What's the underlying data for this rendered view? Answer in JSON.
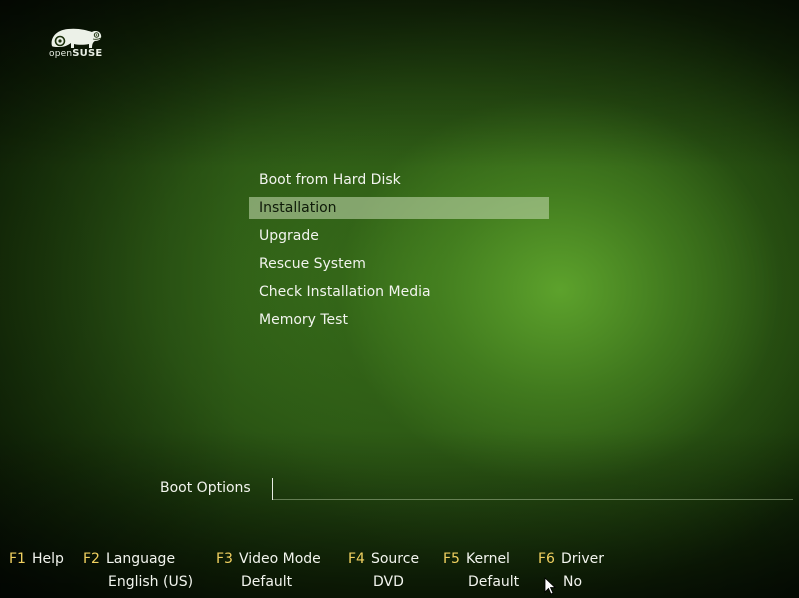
{
  "logo": {
    "icon": "opensuse-chameleon-icon",
    "prefix": "open",
    "brand": "SUSE"
  },
  "menu": {
    "items": [
      {
        "label": "Boot from Hard Disk",
        "selected": false
      },
      {
        "label": "Installation",
        "selected": true
      },
      {
        "label": "Upgrade",
        "selected": false
      },
      {
        "label": "Rescue System",
        "selected": false
      },
      {
        "label": "Check Installation Media",
        "selected": false
      },
      {
        "label": "Memory Test",
        "selected": false
      }
    ]
  },
  "boot_options": {
    "label": "Boot Options",
    "value": ""
  },
  "fkeys": [
    {
      "key": "F1",
      "label": "Help",
      "value": ""
    },
    {
      "key": "F2",
      "label": "Language",
      "value": "English (US)"
    },
    {
      "key": "F3",
      "label": "Video Mode",
      "value": "Default"
    },
    {
      "key": "F4",
      "label": "Source",
      "value": "DVD"
    },
    {
      "key": "F5",
      "label": "Kernel",
      "value": "Default"
    },
    {
      "key": "F6",
      "label": "Driver",
      "value": "No"
    }
  ],
  "colors": {
    "fkey_accent": "#f0d060",
    "text": "#f2f4ee",
    "selection_bg": "#a8c890",
    "selection_text": "#0e1a08",
    "background_center": "#5fa52d",
    "background_edge": "#071205"
  }
}
